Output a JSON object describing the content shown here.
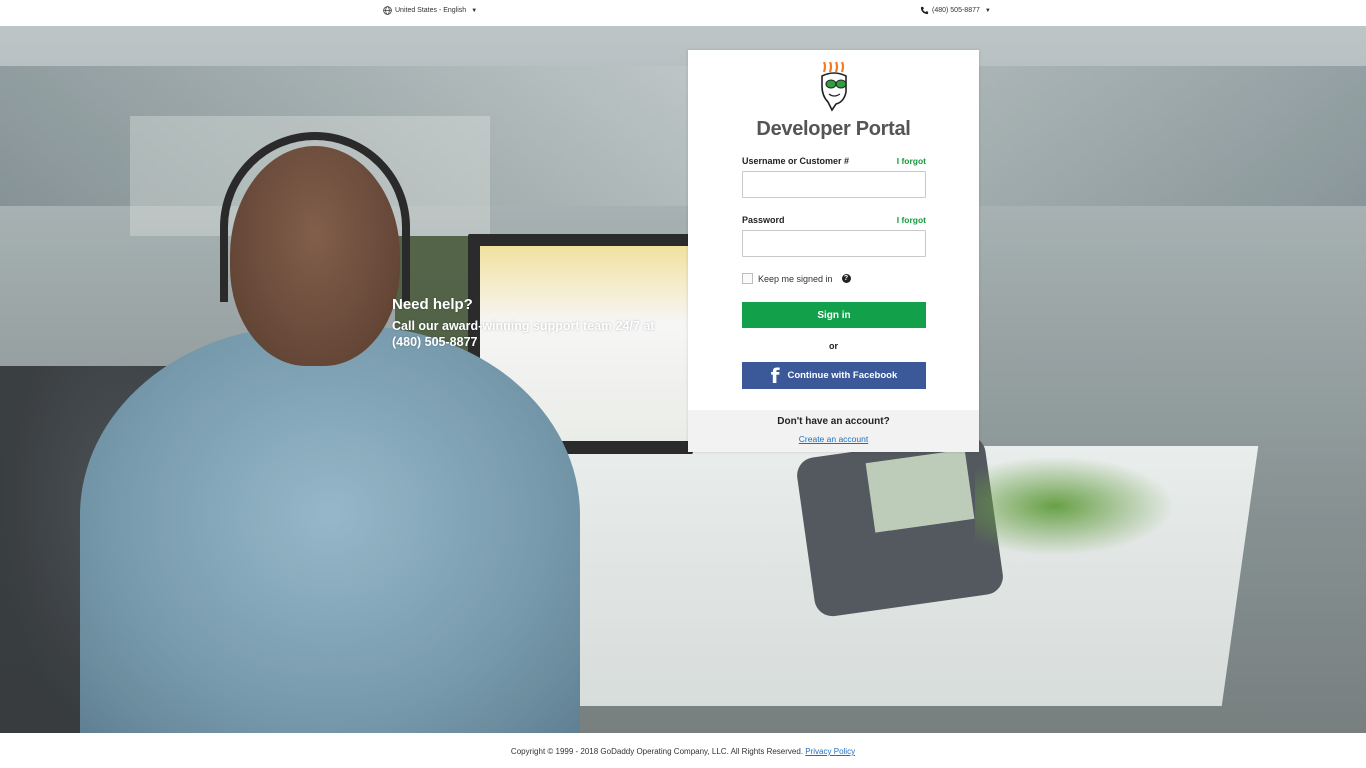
{
  "topbar": {
    "locale_label": "United States - English",
    "phone_label": "(480) 505-8877",
    "icons": {
      "locale": "globe-icon",
      "phone": "phone-icon",
      "dropdown": "caret-down-icon"
    }
  },
  "hero": {
    "help_title": "Need help?",
    "help_body": "Call our award-winning support team 24/7 at (480) 505-8877"
  },
  "login": {
    "title": "Developer Portal",
    "username_label": "Username or Customer #",
    "username_forgot": "I forgot",
    "username_value": "",
    "password_label": "Password",
    "password_forgot": "I forgot",
    "password_value": "",
    "keep_signed_in_label": "Keep me signed in",
    "keep_signed_in_checked": false,
    "help_icon": "question-icon",
    "signin_label": "Sign in",
    "or_label": "or",
    "facebook_label": "Continue with Facebook",
    "no_account_label": "Don't have an account?",
    "create_account_label": "Create an account"
  },
  "footer": {
    "copyright": "Copyright © 1999 - 2018 GoDaddy Operating Company, LLC. All Rights Reserved.",
    "privacy_label": "Privacy Policy"
  },
  "colors": {
    "accent_green": "#13a04a",
    "forgot_green": "#159a3b",
    "facebook_blue": "#3b5998",
    "link_blue": "#1f6fbf"
  }
}
